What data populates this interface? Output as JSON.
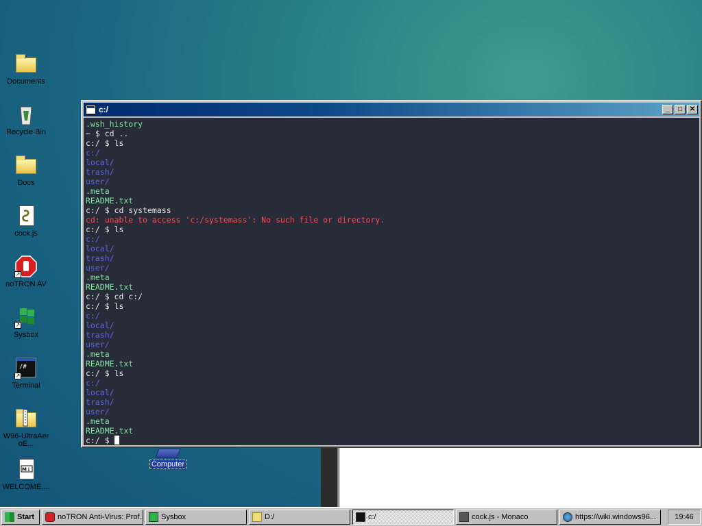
{
  "desktop": {
    "icons": [
      {
        "label": "Documents",
        "icon": "documents-folder-icon"
      },
      {
        "label": "Recycle Bin",
        "icon": "recycle-bin-icon"
      },
      {
        "label": "Docs",
        "icon": "folder-icon"
      },
      {
        "label": "cock.js",
        "icon": "script-file-icon"
      },
      {
        "label": "noTRON AV",
        "icon": "stop-sign-icon"
      },
      {
        "label": "Sysbox",
        "icon": "windows-flag-icon"
      },
      {
        "label": "Terminal",
        "icon": "terminal-icon"
      },
      {
        "label": "W96-UltraAeroE...",
        "icon": "zip-folder-icon"
      },
      {
        "label": "WELCOME....",
        "icon": "markdown-file-icon"
      }
    ],
    "computer_label": "Computer"
  },
  "terminal": {
    "title": "c:/",
    "buttons": {
      "minimize": "_",
      "maximize": "□",
      "close": "✕"
    },
    "lines": [
      {
        "text": ".wsh_history",
        "kind": "file"
      },
      {
        "text": "~ $ cd ..",
        "kind": "cmd"
      },
      {
        "text": "c:/ $ ls",
        "kind": "cmd"
      },
      {
        "text": "c:/",
        "kind": "dir"
      },
      {
        "text": "local/",
        "kind": "dir"
      },
      {
        "text": "trash/",
        "kind": "dir"
      },
      {
        "text": "user/",
        "kind": "dir"
      },
      {
        "text": ".meta",
        "kind": "file"
      },
      {
        "text": "README.txt",
        "kind": "file"
      },
      {
        "text": "c:/ $ cd systemass",
        "kind": "cmd"
      },
      {
        "text": "cd: unable to access 'c:/systemass': No such file or directory.",
        "kind": "err"
      },
      {
        "text": "c:/ $ ls",
        "kind": "cmd"
      },
      {
        "text": "c:/",
        "kind": "dir"
      },
      {
        "text": "local/",
        "kind": "dir"
      },
      {
        "text": "trash/",
        "kind": "dir"
      },
      {
        "text": "user/",
        "kind": "dir"
      },
      {
        "text": ".meta",
        "kind": "file"
      },
      {
        "text": "README.txt",
        "kind": "file"
      },
      {
        "text": "c:/ $ cd c:/",
        "kind": "cmd"
      },
      {
        "text": "c:/ $ ls",
        "kind": "cmd"
      },
      {
        "text": "c:/",
        "kind": "dir"
      },
      {
        "text": "local/",
        "kind": "dir"
      },
      {
        "text": "trash/",
        "kind": "dir"
      },
      {
        "text": "user/",
        "kind": "dir"
      },
      {
        "text": ".meta",
        "kind": "file"
      },
      {
        "text": "README.txt",
        "kind": "file"
      },
      {
        "text": "c:/ $ ls",
        "kind": "cmd"
      },
      {
        "text": "c:/",
        "kind": "dir"
      },
      {
        "text": "local/",
        "kind": "dir"
      },
      {
        "text": "trash/",
        "kind": "dir"
      },
      {
        "text": "user/",
        "kind": "dir"
      },
      {
        "text": ".meta",
        "kind": "file"
      },
      {
        "text": "README.txt",
        "kind": "file"
      }
    ],
    "prompt": "c:/ $ "
  },
  "taskbar": {
    "start_label": "Start",
    "items": [
      {
        "label": "noTRON Anti-Virus: Prof...",
        "icon": "stop-sign-icon",
        "active": false
      },
      {
        "label": "Sysbox",
        "icon": "windows-flag-icon",
        "active": false
      },
      {
        "label": "D:/",
        "icon": "folder-icon",
        "active": false
      },
      {
        "label": "c:/",
        "icon": "terminal-icon",
        "active": true
      },
      {
        "label": "cock.js - Monaco",
        "icon": "code-editor-icon",
        "active": false
      },
      {
        "label": "https://wiki.windows96...",
        "icon": "browser-globe-icon",
        "active": false
      }
    ],
    "clock": "19:46"
  },
  "colors": {
    "console_bg": "#282b38",
    "file": "#83e3a0",
    "dir": "#5b67e6",
    "error": "#ff4b4b",
    "cmd": "#e8e8e8"
  }
}
